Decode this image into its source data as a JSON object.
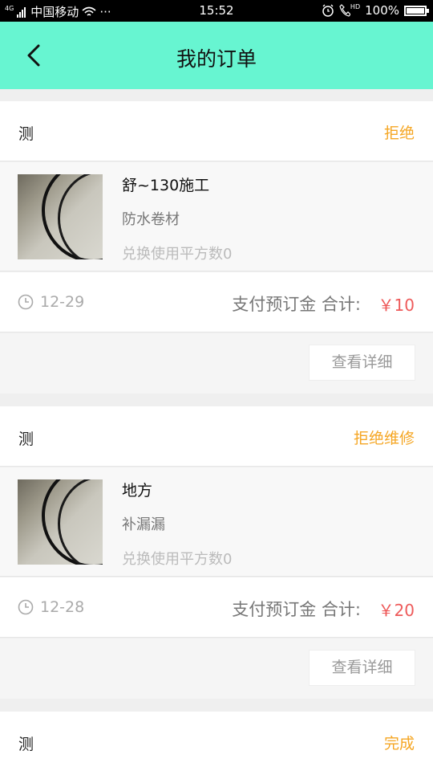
{
  "status_bar": {
    "carrier": "中国移动",
    "dots": "···",
    "time": "15:52",
    "hd": "HD",
    "battery": "100%",
    "net": "4G"
  },
  "header": {
    "title": "我的订单"
  },
  "orders": [
    {
      "name": "测",
      "status": "拒绝",
      "product_title": "舒~130施工",
      "product_sub": "防水卷材",
      "exchange": "兑换使用平方数0",
      "date": "12-29",
      "total_label": "支付预订金 合计:",
      "total": "￥10",
      "detail_button": "查看详细"
    },
    {
      "name": "测",
      "status": "拒绝维修",
      "product_title": "地方",
      "product_sub": "补漏漏",
      "exchange": "兑换使用平方数0",
      "date": "12-28",
      "total_label": "支付预订金 合计:",
      "total": "￥20",
      "detail_button": "查看详细"
    },
    {
      "name": "测",
      "status": "完成"
    }
  ],
  "colors": {
    "header_bg": "#67f5d1",
    "status_orange": "#f5a623",
    "price_red": "#ee5a5a"
  }
}
